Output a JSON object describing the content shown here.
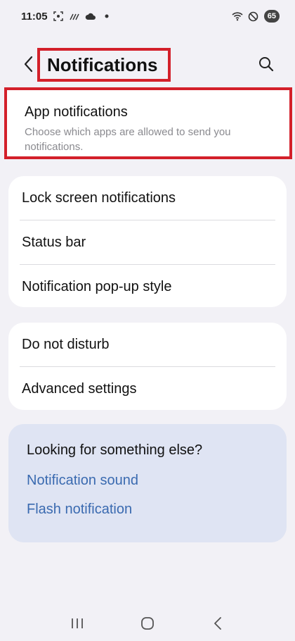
{
  "status_bar": {
    "time": "11:05",
    "battery": "65",
    "left_icons": [
      "screenshot-icon",
      "signal-bars-icon",
      "cloud-icon",
      "dot-icon"
    ],
    "right_icons": [
      "wifi-icon",
      "do-not-disturb-icon",
      "battery-icon"
    ]
  },
  "header": {
    "title": "Notifications",
    "back_icon": "chevron-left-icon",
    "search_icon": "search-icon"
  },
  "app_notifications": {
    "title": "App notifications",
    "subtitle": "Choose which apps are allowed to send you notifications."
  },
  "group1": {
    "items": [
      {
        "label": "Lock screen notifications"
      },
      {
        "label": "Status bar"
      },
      {
        "label": "Notification pop-up style"
      }
    ]
  },
  "group2": {
    "items": [
      {
        "label": "Do not disturb"
      },
      {
        "label": "Advanced settings"
      }
    ]
  },
  "suggestions": {
    "heading": "Looking for something else?",
    "links": [
      {
        "label": "Notification sound"
      },
      {
        "label": "Flash notification"
      }
    ]
  },
  "colors": {
    "highlight": "#d3202a",
    "link": "#3a6ab0",
    "background": "#f2f1f6",
    "suggest_card": "#dfe4f3"
  }
}
